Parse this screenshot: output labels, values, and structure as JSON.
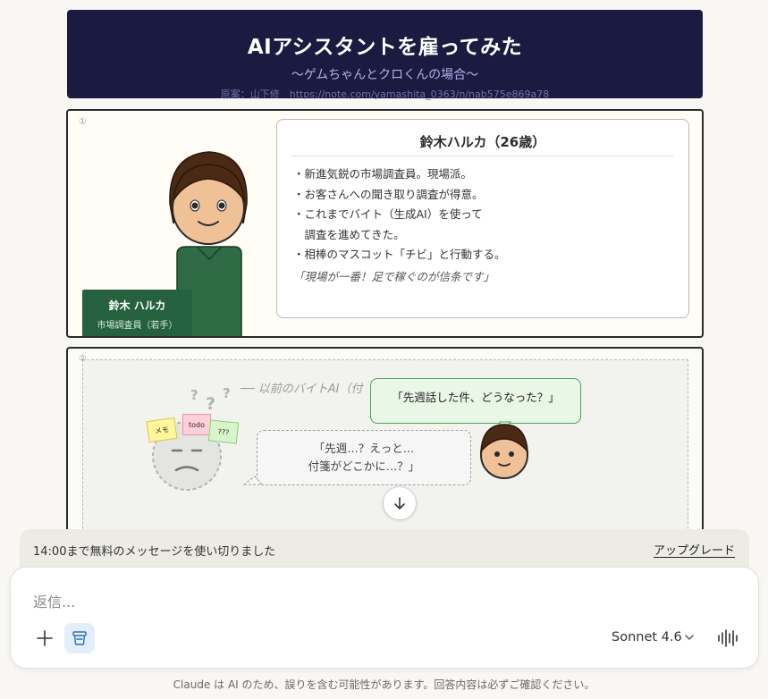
{
  "header": {
    "title": "AIアシスタントを雇ってみた",
    "subtitle": "〜ゲムちゃんとクロくんの場合〜",
    "credit": "原案：山下修　https://note.com/yamashita_0363/n/nab575e869a78"
  },
  "panel1": {
    "number": "①",
    "nametag": {
      "name": "鈴木 ハルカ",
      "role": "市場調査員（若手）"
    },
    "profile": {
      "title": "鈴木ハルカ（26歳）",
      "lines": [
        "・新進気鋭の市場調査員。現場派。",
        "・お客さんへの聞き取り調査が得意。",
        "・これまでバイト（生成AI）を使って",
        "　調査を進めてきた。",
        "・相棒のマスコット「チビ」と行動する。"
      ],
      "quote": "「現場が一番！足で稼ぐのが信条です」"
    }
  },
  "panel2": {
    "number": "②",
    "label": "── 以前のバイトAI（付",
    "question_marks": [
      "?",
      "?",
      "?"
    ],
    "stickies": [
      "メモ",
      "todo",
      "???"
    ],
    "old_bubble": [
      "「先週…？えっと…",
      "付箋がどこかに…？」"
    ],
    "new_bubble": "「先週話した件、どうなった？」"
  },
  "limit_bar": {
    "message": "14:00まで無料のメッセージを使い切りました",
    "upgrade": "アップグレード"
  },
  "composer": {
    "placeholder": "返信...",
    "model": "Sonnet 4.6"
  },
  "disclaimer": "Claude は AI のため、誤りを含む可能性があります。回答内容は必ずご確認ください。",
  "icons": {
    "plus": "plus-icon",
    "project": "project-icon",
    "chevron": "chevron-down-icon",
    "voice": "voice-icon",
    "scroll": "arrow-down-icon"
  },
  "colors": {
    "header_bg": "#1b1a40",
    "nametag_bg": "#25613f",
    "new_bubble_border": "#4aa55b",
    "upgrade_text": "#222222"
  }
}
